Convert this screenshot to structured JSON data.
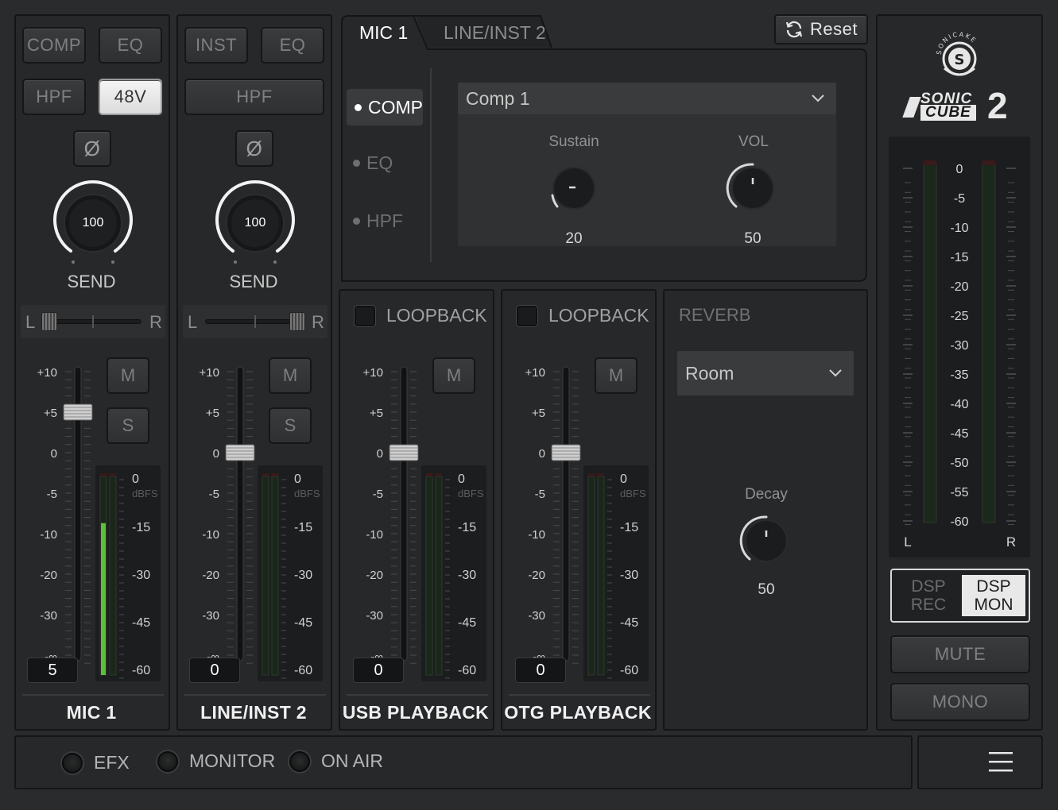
{
  "mic1": {
    "buttons": {
      "comp": "COMP",
      "eq": "EQ",
      "hpf": "HPF",
      "phantom": "48V",
      "phase": "Ø"
    },
    "send_value": "100",
    "send_label": "SEND",
    "pan": {
      "left": "L",
      "right": "R",
      "position": 0.0
    },
    "fader": {
      "scale": [
        "+10",
        "+5",
        "0",
        "-5",
        "-10",
        "-20",
        "-30",
        "-∞"
      ],
      "value": "5"
    },
    "mute": "M",
    "solo": "S",
    "meter": {
      "labels": [
        "0",
        "dBFS",
        "-15",
        "-30",
        "-45",
        "-60"
      ],
      "level": 0.7
    },
    "name": "MIC 1"
  },
  "line2": {
    "buttons": {
      "inst": "INST",
      "eq": "EQ",
      "hpf": "HPF",
      "phase": "Ø"
    },
    "send_value": "100",
    "send_label": "SEND",
    "pan": {
      "left": "L",
      "right": "R",
      "position": 1.0
    },
    "fader": {
      "scale": [
        "+10",
        "+5",
        "0",
        "-5",
        "-10",
        "-20",
        "-30",
        "-∞"
      ],
      "value": "0"
    },
    "mute": "M",
    "solo": "S",
    "meter": {
      "labels": [
        "0",
        "dBFS",
        "-15",
        "-30",
        "-45",
        "-60"
      ],
      "level": 0
    },
    "name": "LINE/INST 2"
  },
  "usb": {
    "loopback": "LOOPBACK",
    "fader": {
      "scale": [
        "+10",
        "+5",
        "0",
        "-5",
        "-10",
        "-20",
        "-30",
        "-∞"
      ],
      "value": "0"
    },
    "mute": "M",
    "meter": {
      "labels": [
        "0",
        "dBFS",
        "-15",
        "-30",
        "-45",
        "-60"
      ],
      "level": 0
    },
    "name": "USB PLAYBACK"
  },
  "otg": {
    "loopback": "LOOPBACK",
    "fader": {
      "scale": [
        "+10",
        "+5",
        "0",
        "-5",
        "-10",
        "-20",
        "-30",
        "-∞"
      ],
      "value": "0"
    },
    "mute": "M",
    "meter": {
      "labels": [
        "0",
        "dBFS",
        "-15",
        "-30",
        "-45",
        "-60"
      ],
      "level": 0
    },
    "name": "OTG PLAYBACK"
  },
  "fx": {
    "tabs": [
      "MIC 1",
      "LINE/INST 2"
    ],
    "reset": "Reset",
    "sub_items": [
      "COMP",
      "EQ",
      "HPF"
    ],
    "preset": "Comp 1",
    "knobs": [
      {
        "label": "Sustain",
        "value": "20"
      },
      {
        "label": "VOL",
        "value": "50"
      }
    ]
  },
  "reverb": {
    "title": "REVERB",
    "preset": "Room",
    "knob": {
      "label": "Decay",
      "value": "50"
    }
  },
  "master": {
    "brand": {
      "logo_ring": "SONICAKE",
      "wordmark": "SONIC",
      "wordmark2": "CUBE",
      "model": "2"
    },
    "meter_scale": [
      "0",
      "-5",
      "-10",
      "-15",
      "-20",
      "-25",
      "-30",
      "-35",
      "-40",
      "-45",
      "-50",
      "-55",
      "-60"
    ],
    "left": "L",
    "right": "R",
    "dsp_rec": [
      "DSP",
      "REC"
    ],
    "dsp_mon": [
      "DSP",
      "MON"
    ],
    "mute": "MUTE",
    "mono": "MONO"
  },
  "footer": {
    "status": [
      "EFX",
      "MONITOR",
      "ON AIR"
    ],
    "menu_icon": "hamburger-menu-icon"
  },
  "colors": {
    "meter_green": "#5fbf3a",
    "panel": "#272829",
    "background": "#2a2b2d"
  }
}
